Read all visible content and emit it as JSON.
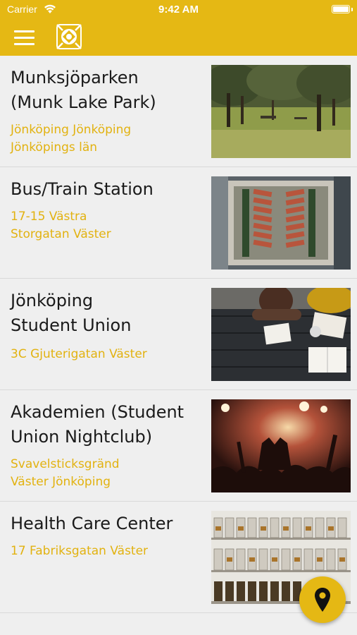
{
  "status_bar": {
    "carrier": "Carrier",
    "time": "9:42 AM"
  },
  "nav": {
    "menu_icon": "hamburger-menu-icon",
    "logo_icon": "app-logo-icon"
  },
  "places": [
    {
      "title": "Munksjöparken\n(Munk Lake Park)",
      "address": "Jönköping Jönköping\nJönköpings län",
      "image": "park-trees-photo"
    },
    {
      "title": "Bus/Train Station",
      "address": "17-15 Västra\nStorgatan Väster",
      "image": "station-aerial-photo"
    },
    {
      "title": "Jönköping\nStudent Union",
      "address": "3C Gjuterigatan Väster",
      "image": "students-studying-photo"
    },
    {
      "title": "Akademien (Student\nUnion Nightclub)",
      "address": "Svavelsticksgränd\nVäster Jönköping",
      "image": "nightclub-concert-photo"
    },
    {
      "title": "Health Care Center",
      "address": "17 Fabriksgatan Väster",
      "image": "pharmacy-bottles-photo"
    }
  ],
  "fab": {
    "icon": "map-pin-icon"
  },
  "colors": {
    "brand": "#e5b814",
    "address_text": "#e2b210",
    "background": "#efefef"
  }
}
